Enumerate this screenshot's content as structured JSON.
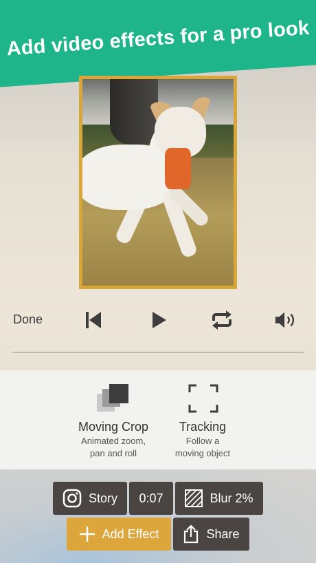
{
  "banner": {
    "title": "Add video effects for a pro look",
    "color": "#1fb58a"
  },
  "video": {
    "border_color": "#d7a73a"
  },
  "player": {
    "done_label": "Done",
    "icons": [
      "skip-back-icon",
      "play-icon",
      "loop-icon",
      "volume-icon"
    ]
  },
  "tools": [
    {
      "title": "Moving Crop",
      "subtitle_line1": "Animated zoom,",
      "subtitle_line2": "pan and roll",
      "icon": "layers-crop-icon"
    },
    {
      "title": "Tracking",
      "subtitle_line1": "Follow a",
      "subtitle_line2": "moving object",
      "icon": "tracking-frame-icon"
    }
  ],
  "actions": {
    "story_label": "Story",
    "duration_label": "0:07",
    "blur_label": "Blur 2%",
    "add_effect_label": "Add Effect",
    "share_label": "Share",
    "button_color": "#4a4542",
    "accent_color": "#dca63c"
  }
}
